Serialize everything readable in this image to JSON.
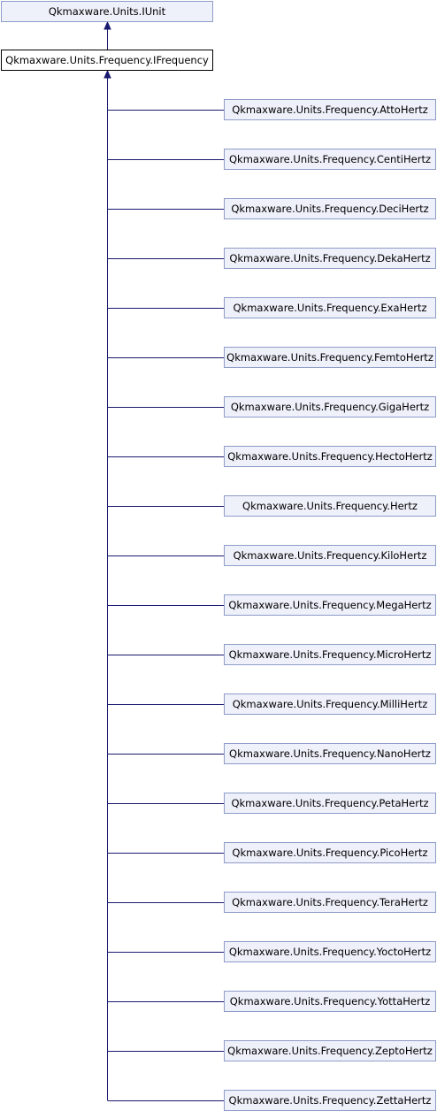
{
  "diagram": {
    "colors": {
      "edge": "#191970",
      "node_fill": "#eef0fa",
      "node_border": "#8e9cc8",
      "current_fill": "#ffffff",
      "current_border": "#000000"
    },
    "base": "Qkmaxware.Units.IUnit",
    "current": "Qkmaxware.Units.Frequency.IFrequency",
    "children": [
      "Qkmaxware.Units.Frequency.AttoHertz",
      "Qkmaxware.Units.Frequency.CentiHertz",
      "Qkmaxware.Units.Frequency.DeciHertz",
      "Qkmaxware.Units.Frequency.DekaHertz",
      "Qkmaxware.Units.Frequency.ExaHertz",
      "Qkmaxware.Units.Frequency.FemtoHertz",
      "Qkmaxware.Units.Frequency.GigaHertz",
      "Qkmaxware.Units.Frequency.HectoHertz",
      "Qkmaxware.Units.Frequency.Hertz",
      "Qkmaxware.Units.Frequency.KiloHertz",
      "Qkmaxware.Units.Frequency.MegaHertz",
      "Qkmaxware.Units.Frequency.MicroHertz",
      "Qkmaxware.Units.Frequency.MilliHertz",
      "Qkmaxware.Units.Frequency.NanoHertz",
      "Qkmaxware.Units.Frequency.PetaHertz",
      "Qkmaxware.Units.Frequency.PicoHertz",
      "Qkmaxware.Units.Frequency.TeraHertz",
      "Qkmaxware.Units.Frequency.YoctoHertz",
      "Qkmaxware.Units.Frequency.YottaHertz",
      "Qkmaxware.Units.Frequency.ZeptoHertz",
      "Qkmaxware.Units.Frequency.ZettaHertz"
    ]
  }
}
